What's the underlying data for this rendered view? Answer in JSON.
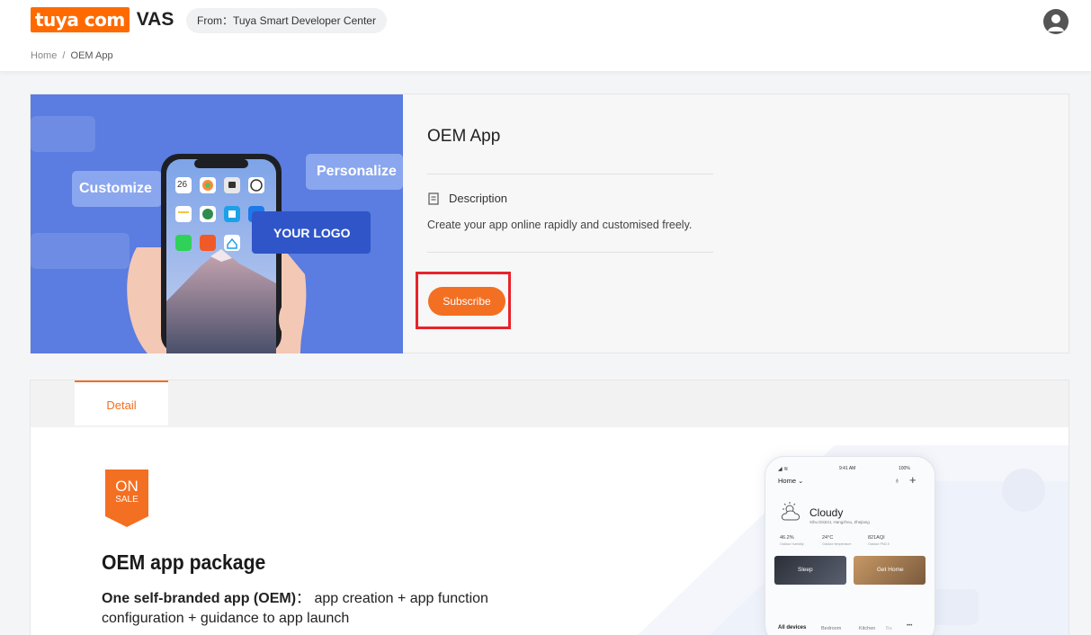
{
  "header": {
    "logo_text": "tuya com",
    "logo_suffix": "VAS",
    "from_label": "From：Tuya Smart Developer Center",
    "avatar_icon": "user-avatar-icon"
  },
  "breadcrumb": {
    "home": "Home",
    "separator": "/",
    "current": "OEM App"
  },
  "banner": {
    "customize": "Customize",
    "personalize": "Personalize",
    "your_logo": "YOUR LOGO",
    "date_icon_text": "26"
  },
  "product": {
    "title": "OEM App",
    "description_label": "Description",
    "description_text": "Create your app online rapidly and customised freely.",
    "subscribe_label": "Subscribe"
  },
  "tabs": [
    {
      "label": "Detail",
      "active": true
    }
  ],
  "detail": {
    "badge_on": "ON",
    "badge_sale": "SALE",
    "package_title": "OEM app package",
    "package_bold": "One self-branded app (OEM)",
    "package_rest": "： app creation + app function configuration + guidance to app launch"
  },
  "phone_mockup": {
    "time": "9:41 AM",
    "battery": "100%",
    "home": "Home",
    "weather": "Cloudy",
    "location": "Xihu District, Hangzhou, Zhejiang",
    "stats": [
      {
        "value": "46.2%",
        "label": "Outdoor humidity"
      },
      {
        "value": "24°C",
        "label": "Outdoor temperature"
      },
      {
        "value": "821AQI",
        "label": "Outdoor PM2.5"
      }
    ],
    "scenes": [
      "Sleep",
      "Get Home"
    ],
    "rooms": [
      "All devices",
      "Bedroom",
      "Kitchen",
      "Ba"
    ],
    "more": "•••"
  },
  "colors": {
    "brand": "#ff6a00",
    "accent": "#f36f22",
    "highlight": "#e8232b",
    "banner_bg": "#5b7ce0"
  }
}
